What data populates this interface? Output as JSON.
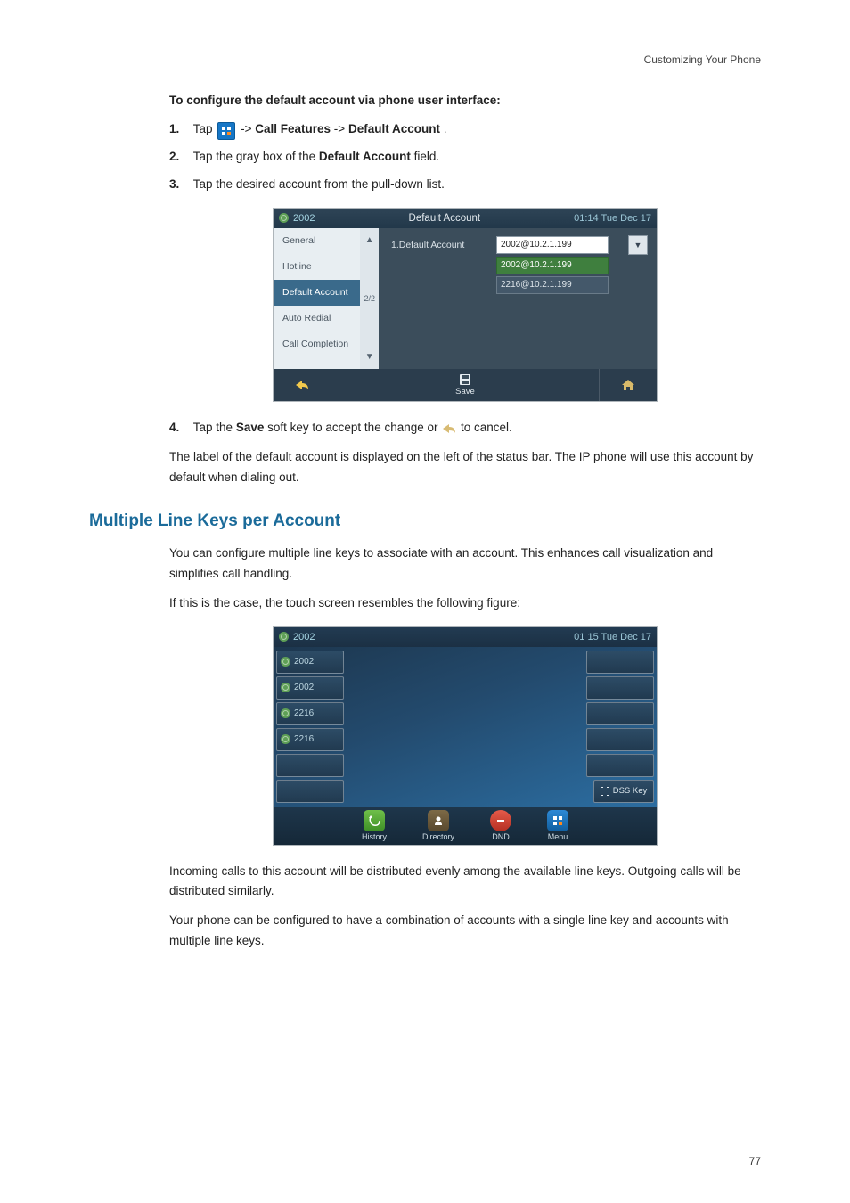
{
  "running_head": "Customizing Your Phone",
  "page_number": "77",
  "intro_bold": "To configure the default account via phone user interface:",
  "steps": {
    "s1_num": "1.",
    "s1_a": "Tap ",
    "s1_b": " ->",
    "s1_c": "Call Features",
    "s1_d": "->",
    "s1_e": "Default Account",
    "s1_f": ".",
    "s2_num": "2.",
    "s2_a": "Tap the gray box of the ",
    "s2_b": "Default Account",
    "s2_c": " field.",
    "s3_num": "3.",
    "s3_text": "Tap the desired account from the pull-down list.",
    "s4_num": "4.",
    "s4_a": "Tap the ",
    "s4_b": "Save",
    "s4_c": " soft key to accept the change or ",
    "s4_d": " to cancel."
  },
  "para_after_steps": "The label of the default account is displayed on the left of the status bar. The IP phone will use this account by default when dialing out.",
  "section_heading": "Multiple Line Keys per Account",
  "para2a": "You can configure multiple line keys to associate with an account. This enhances call visualization and simplifies call handling.",
  "para2b": "If this is the case, the touch screen resembles the following figure:",
  "para3": "Incoming calls to this account will be distributed evenly among the available line keys. Outgoing calls will be distributed similarly.",
  "para4": "Your phone can be configured to have a combination of accounts with a single line key and accounts with multiple line keys.",
  "ss1": {
    "account": "2002",
    "title": "Default Account",
    "time": "01:14 Tue Dec 17",
    "sidebar": {
      "i0": "General",
      "i1": "Hotline",
      "i2": "Default Account",
      "i3": "Auto Redial",
      "i4": "Call Completion"
    },
    "scroll": {
      "page": "2/2"
    },
    "field_label": "1.Default Account",
    "selected": "2002@10.2.1.199",
    "opt_sel": "2002@10.2.1.199",
    "opt_alt": "2216@10.2.1.199",
    "save_label": "Save"
  },
  "ss2": {
    "account": "2002",
    "time": "01 15 Tue Dec 17",
    "lines": {
      "l0": "2002",
      "l1": "2002",
      "l2": "2216",
      "l3": "2216"
    },
    "dss_label": "DSS Key",
    "btn_history": "History",
    "btn_directory": "Directory",
    "btn_dnd": "DND",
    "btn_menu": "Menu"
  }
}
